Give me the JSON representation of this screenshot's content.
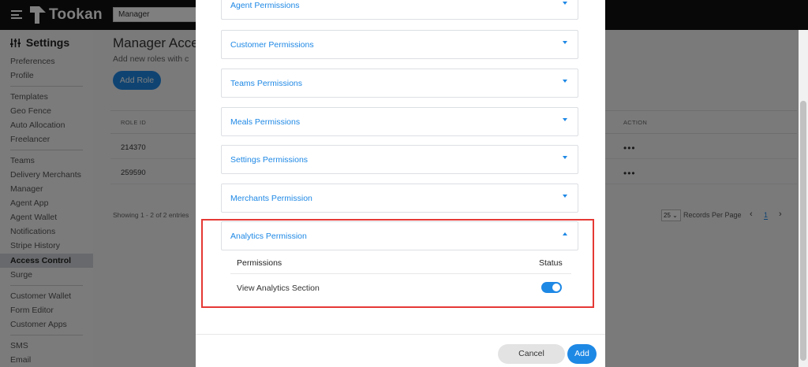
{
  "topbar": {
    "brand": "Tookan",
    "manager_select_value": "Manager"
  },
  "sidebar": {
    "title": "Settings",
    "items": [
      {
        "label": "Preferences"
      },
      {
        "label": "Profile"
      },
      {
        "label": "Templates"
      },
      {
        "label": "Geo Fence"
      },
      {
        "label": "Auto Allocation"
      },
      {
        "label": "Freelancer"
      },
      {
        "label": "Teams"
      },
      {
        "label": "Delivery Merchants"
      },
      {
        "label": "Manager"
      },
      {
        "label": "Agent App"
      },
      {
        "label": "Agent Wallet"
      },
      {
        "label": "Notifications"
      },
      {
        "label": "Stripe History"
      },
      {
        "label": "Access Control"
      },
      {
        "label": "Surge"
      },
      {
        "label": "Customer Wallet"
      },
      {
        "label": "Form Editor"
      },
      {
        "label": "Customer Apps"
      },
      {
        "label": "SMS"
      },
      {
        "label": "Email"
      }
    ]
  },
  "main": {
    "title": "Manager Acce",
    "subtitle": "Add new roles with c",
    "add_role_label": "Add Role",
    "table": {
      "col_role_id": "ROLE ID",
      "col_action": "ACTION",
      "rows": [
        {
          "role_id": "214370",
          "action": "•••"
        },
        {
          "role_id": "259590",
          "action": "•••"
        }
      ]
    },
    "showing_text": "Showing 1 - 2 of 2 entries",
    "records_per_page_value": "25",
    "records_per_page_label": "Records Per Page",
    "page_prev": "‹",
    "page_current": "1",
    "page_next": "›"
  },
  "modal": {
    "sections": [
      {
        "label": "Agent Permissions",
        "expanded": false
      },
      {
        "label": "Customer Permissions",
        "expanded": false
      },
      {
        "label": "Teams Permissions",
        "expanded": false
      },
      {
        "label": "Meals Permissions",
        "expanded": false
      },
      {
        "label": "Settings Permissions",
        "expanded": false
      },
      {
        "label": "Merchants Permission",
        "expanded": false
      },
      {
        "label": "Analytics Permission",
        "expanded": true
      }
    ],
    "analytics_table": {
      "header_permissions": "Permissions",
      "header_status": "Status",
      "rows": [
        {
          "label": "View Analytics Section",
          "enabled": true
        }
      ]
    },
    "cancel_label": "Cancel",
    "add_label": "Add"
  },
  "colors": {
    "accent": "#1e88e5",
    "highlight": "#e53935",
    "topbar": "#111111"
  }
}
